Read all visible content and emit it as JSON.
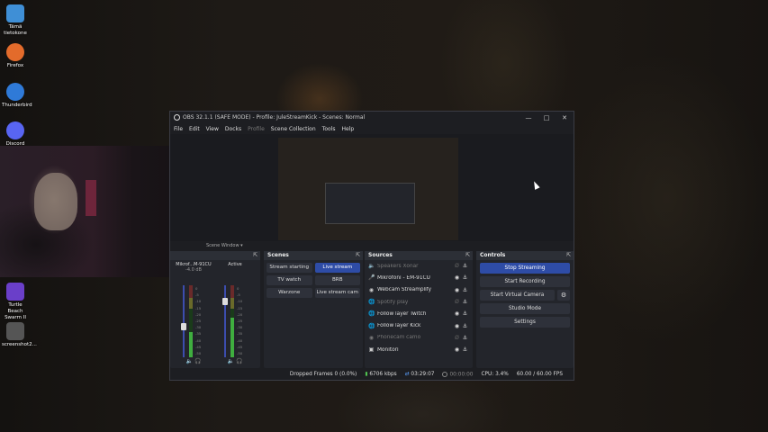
{
  "desktop": {
    "icons": [
      {
        "label": "Tämä tietokone",
        "color": "#3f8fd6"
      },
      {
        "label": "Firefox",
        "color": "#e36b2b"
      },
      {
        "label": "Thunderbird",
        "color": "#2f7ad8"
      },
      {
        "label": "Discord",
        "color": "#5865f2"
      },
      {
        "label": "Turtle Beach Swarm II",
        "color": "#6a3fc9"
      },
      {
        "label": "screenshot2...",
        "color": "#555"
      }
    ]
  },
  "obs": {
    "title": "OBS 32.1.1 (SAFE MODE) - Profile: JuleStreamKick - Scenes: Normal",
    "menu": [
      "File",
      "Edit",
      "View",
      "Docks",
      "Profile",
      "Scene Collection",
      "Tools",
      "Help"
    ],
    "dock_strip": "Scene Window",
    "mixer": {
      "channels": [
        {
          "name": "Mikrof...M-91CU",
          "db": "-4.0 dB",
          "level": 0.35
        },
        {
          "name": "Active",
          "db": "",
          "level": 0.55
        }
      ],
      "scale": [
        "0",
        "-5",
        "-10",
        "-15",
        "-20",
        "-25",
        "-30",
        "-35",
        "-40",
        "-45",
        "-50"
      ]
    },
    "scenes": {
      "title": "Scenes",
      "items": [
        {
          "label": "Stream starting",
          "active": false
        },
        {
          "label": "Live stream",
          "active": true
        },
        {
          "label": "TV watch",
          "active": false
        },
        {
          "label": "BRB",
          "active": false
        },
        {
          "label": "Warzone",
          "active": false
        },
        {
          "label": "Live stream cam",
          "active": false
        }
      ]
    },
    "sources": {
      "title": "Sources",
      "items": [
        {
          "label": "Speakers Xonar",
          "icon": "speaker-icon",
          "visible": false
        },
        {
          "label": "Mikrofoni - EM-91CU",
          "icon": "microphone-icon",
          "visible": true
        },
        {
          "label": "Webcam Streamplify",
          "icon": "camera-icon",
          "visible": true
        },
        {
          "label": "Spotify play",
          "icon": "globe-icon",
          "visible": false
        },
        {
          "label": "Follow layer Twitch",
          "icon": "globe-icon",
          "visible": true
        },
        {
          "label": "Follow layer Kick",
          "icon": "globe-icon",
          "visible": true
        },
        {
          "label": "Phonecam camo",
          "icon": "camera-icon",
          "visible": false
        },
        {
          "label": "Monitori",
          "icon": "monitor-icon",
          "visible": true
        }
      ]
    },
    "controls": {
      "title": "Controls",
      "stop_streaming": "Stop Streaming",
      "start_recording": "Start Recording",
      "start_virtual_camera": "Start Virtual Camera",
      "studio_mode": "Studio Mode",
      "settings": "Settings"
    },
    "status": {
      "dropped_frames": "Dropped Frames 0 (0.0%)",
      "bitrate": "6706 kbps",
      "stream_time": "03:29:07",
      "record_time": "00:00:00",
      "cpu": "CPU: 3.4%",
      "fps": "60.00 / 60.00 FPS"
    }
  },
  "colors": {
    "accent": "#2e4ca6",
    "meter_green": "#3fae3f"
  }
}
